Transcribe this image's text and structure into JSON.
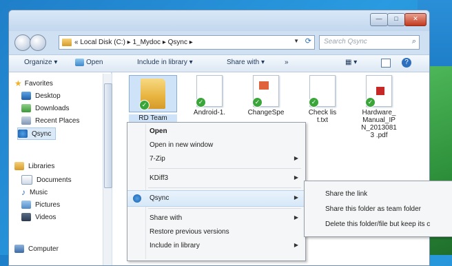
{
  "window": {
    "address": "« Local Disk (C:) ▸ 1_Mydoc ▸ Qsync ▸",
    "search_placeholder": "Search Qsync",
    "caption": {
      "minimize": "—",
      "maximize": "□",
      "close": "✕"
    }
  },
  "toolbar": {
    "organize": "Organize ▾",
    "open": "Open",
    "include_in_library": "Include in library ▾",
    "share_with": "Share with ▾",
    "more": "»",
    "views": "▦ ▾",
    "help": "?"
  },
  "nav": {
    "favorites": "Favorites",
    "desktop": "Desktop",
    "downloads": "Downloads",
    "recent_places": "Recent Places",
    "qsync": "Qsync",
    "libraries": "Libraries",
    "documents": "Documents",
    "music": "Music",
    "pictures": "Pictures",
    "videos": "Videos",
    "computer": "Computer"
  },
  "files": [
    {
      "label": "RD Team",
      "type": "folder",
      "selected": true
    },
    {
      "label": "Android-1.",
      "type": "doc"
    },
    {
      "label": "ChangeSpe",
      "type": "ppt"
    },
    {
      "label": "Check list.txt",
      "type": "doc"
    },
    {
      "label": "Hardware_ Manual_IP N_20130813 .pdf",
      "type": "pdf"
    }
  ],
  "context_menu": {
    "open": "Open",
    "open_new_window": "Open in new window",
    "seven_zip": "7-Zip",
    "kdiff3": "KDiff3",
    "qsync": "Qsync",
    "share_with": "Share with",
    "restore_previous": "Restore previous versions",
    "include_in_library": "Include in library"
  },
  "qsync_submenu": {
    "share_link": "Share the link",
    "share_team_folder": "Share this folder as team folder",
    "delete_keep": "Delete this folder/file but keep its c"
  },
  "colors": {
    "accent": "#3aa63a",
    "selection": "#cfe3f8",
    "titlebar": "#c2d7ee"
  }
}
